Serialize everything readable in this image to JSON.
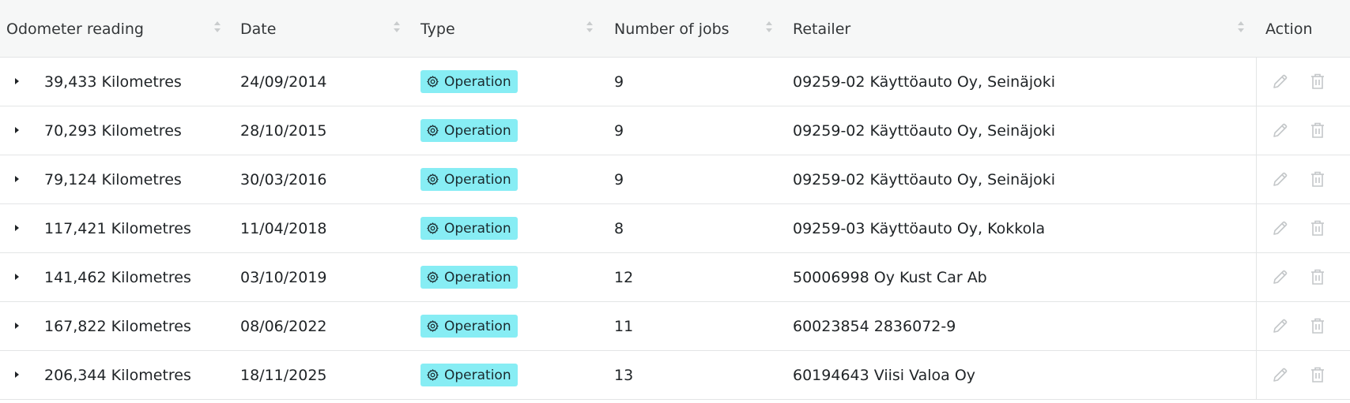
{
  "table": {
    "columns": {
      "odometer": "Odometer reading",
      "date": "Date",
      "type": "Type",
      "jobs": "Number of jobs",
      "retailer": "Retailer",
      "action": "Action"
    },
    "rows": [
      {
        "odometer": "39,433 Kilometres",
        "date": "24/09/2014",
        "type": "Operation",
        "jobs": "9",
        "retailer": "09259-02 Käyttöauto Oy, Seinäjoki"
      },
      {
        "odometer": "70,293 Kilometres",
        "date": "28/10/2015",
        "type": "Operation",
        "jobs": "9",
        "retailer": "09259-02 Käyttöauto Oy, Seinäjoki"
      },
      {
        "odometer": "79,124 Kilometres",
        "date": "30/03/2016",
        "type": "Operation",
        "jobs": "9",
        "retailer": "09259-02 Käyttöauto Oy, Seinäjoki"
      },
      {
        "odometer": "117,421 Kilometres",
        "date": "11/04/2018",
        "type": "Operation",
        "jobs": "8",
        "retailer": "09259-03 Käyttöauto Oy, Kokkola"
      },
      {
        "odometer": "141,462 Kilometres",
        "date": "03/10/2019",
        "type": "Operation",
        "jobs": "12",
        "retailer": "50006998 Oy Kust Car Ab"
      },
      {
        "odometer": "167,822 Kilometres",
        "date": "08/06/2022",
        "type": "Operation",
        "jobs": "11",
        "retailer": "60023854 2836072-9"
      },
      {
        "odometer": "206,344 Kilometres",
        "date": "18/11/2025",
        "type": "Operation",
        "jobs": "13",
        "retailer": "60194643 Viisi Valoa Oy"
      }
    ]
  },
  "icons": {
    "sort": "sort-icon",
    "expand": "caret-right-icon",
    "type": "gear-icon",
    "edit": "pencil-icon",
    "delete": "trash-icon"
  },
  "colors": {
    "header_bg": "#f6f7f7",
    "badge_bg": "#87edf4",
    "border": "#e3e5e6",
    "icon_muted": "#c4c7c9"
  }
}
